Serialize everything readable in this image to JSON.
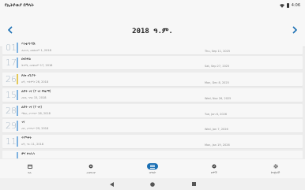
{
  "status": {
    "app_name": "የኢትዮጵያ በዓላት",
    "time": "4:06"
  },
  "header": {
    "month_title": "2018 ዓ.ም."
  },
  "colors": {
    "accent": "#1a6fb3",
    "day_number": "#a9b8c6"
  },
  "rows": [
    {
      "day": "01",
      "name": "እንቁጣጣሽ",
      "eth_date": "ሐሙስ, መስከረም 1, 2018",
      "greg_date": "Thu, Sep 11, 2025",
      "bar_color": "#7fb2e0"
    },
    {
      "day": "17",
      "name": "መስቀል",
      "eth_date": "ቅዳሜ, መስከረም 17, 2018",
      "greg_date": "Sat, Sep 27, 2025",
      "bar_color": "#7fb2e0"
    },
    {
      "day": "26",
      "name": "ጾመ ነቢያት",
      "eth_date": "ሰኞ, ጥቅምት 26, 2018",
      "greg_date": "Mon, Dec 8, 2025",
      "bar_color": "#e3c85a"
    },
    {
      "day": "15",
      "name": "ልደት ገና (የ ገና ዋዜማ)",
      "eth_date": "ረቡዕ, ኅዳር 15, 2018",
      "greg_date": "Wed, Nov 26, 2025",
      "bar_color": "#7fb2e0"
    },
    {
      "day": "28",
      "name": "ልደት ገና (የ ገና)",
      "eth_date": "ማክሰ, ታኅሣሥ 28, 2018",
      "greg_date": "Tue, Jan 6, 2026",
      "bar_color": "#7fb2e0"
    },
    {
      "day": "29",
      "name": "ገና",
      "eth_date": "ረቡ, ታኅሣሥ 29, 2018",
      "greg_date": "Wed, Jan 7, 2026",
      "bar_color": "#7fb2e0"
    },
    {
      "day": "11",
      "name": "ጥምቀት",
      "eth_date": "ሰኞ, ጥር 11, 2018",
      "greg_date": "Mon, Jan 19, 2026",
      "bar_color": "#7fb2e0"
    },
    {
      "day": "",
      "name": "ቃና ዘገሊላ",
      "eth_date": "",
      "greg_date": "",
      "bar_color": "#7fb2e0"
    }
  ],
  "bottom_nav": [
    {
      "label": "ዛሬ",
      "icon": "calendar-icon"
    },
    {
      "label": "መቀየሪያ",
      "icon": "convert-icon"
    },
    {
      "label": "በዓላት",
      "icon": "list-icon",
      "active": true
    },
    {
      "label": "ጾሞች",
      "icon": "compass-icon"
    },
    {
      "label": "ቅንጅቶች",
      "icon": "gear-icon"
    }
  ]
}
